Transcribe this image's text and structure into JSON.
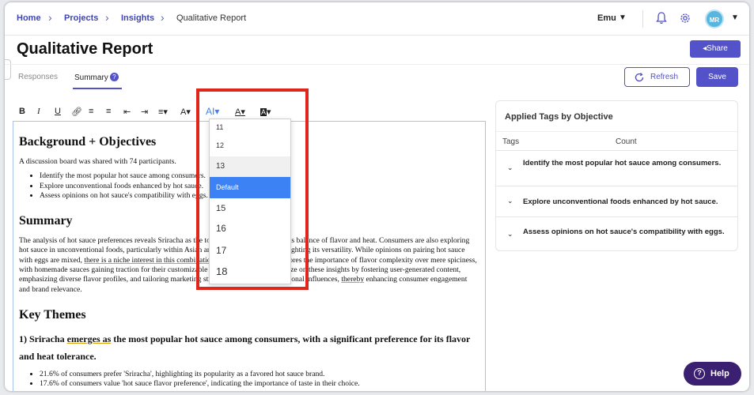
{
  "breadcrumb": [
    {
      "label": "Home"
    },
    {
      "label": "Projects"
    },
    {
      "label": "Insights"
    },
    {
      "label": "Qualitative Report"
    }
  ],
  "user": {
    "name": "Emu",
    "initials": "MR"
  },
  "page": {
    "title": "Qualitative Report",
    "share_label": "Share"
  },
  "tabs": [
    {
      "label": "Responses",
      "active": false
    },
    {
      "label": "Summary",
      "active": true,
      "badge": "?"
    }
  ],
  "actions": {
    "refresh_label": "Refresh",
    "save_label": "Save"
  },
  "toolbar": {
    "bold": "B",
    "italic": "I",
    "underline": "U",
    "font_size_icon": "AI",
    "text_color_icon": "A",
    "highlight_icon": "A"
  },
  "font_size_dropdown": {
    "options": [
      "11",
      "12",
      "13",
      "Default",
      "15",
      "16",
      "17",
      "18"
    ],
    "selected": "Default",
    "hovered": "13"
  },
  "document": {
    "h_background": "Background + Objectives",
    "intro": "A discussion board was shared with 74 participants.",
    "objectives": [
      "Identify the most popular hot sauce among consumers.",
      "Explore unconventional foods enhanced by hot sauce.",
      "Assess opinions on hot sauce's compatibility with eggs."
    ],
    "h_summary": "Summary",
    "summary_p1": "The analysis of hot sauce preferences reveals Sriracha as the top choice, appreciated for its balance of flavor and heat. Consumers are also exploring hot sauce in unconventional foods, particularly within Asian and Mexican cuisines, highlighting its versatility. While opinions on pairing hot sauce with eggs are mixed, ",
    "summary_niche": "there is a niche interest in this combination",
    "summary_p2": ". The discussion underscores the importance of flavor complexity over mere spiciness, with homemade sauces gaining traction for their customizable nature. Brands can capitalize on these insights by fostering user-generated content, emphasizing diverse flavor profiles, and tailoring marketing strategies to cultural and regional influences, ",
    "summary_thereby": "thereby",
    "summary_p3": " enhancing consumer engagement and brand relevance.",
    "h_themes": "Key Themes",
    "theme1_a": "1) Sriracha ",
    "theme1_emerges": "emerges as",
    "theme1_b": " the most popular hot sauce among consumers, with a significant preference for its flavor and heat tolerance.",
    "theme1_points": [
      "21.6% of consumers prefer 'Sriracha', highlighting its popularity as a favored hot sauce brand.",
      "17.6% of consumers value 'hot sauce flavor preference', indicating the importance of taste in their choice."
    ]
  },
  "panel": {
    "title": "Applied Tags by Objective",
    "col_tags": "Tags",
    "col_count": "Count",
    "rows": [
      "Identify the most popular hot sauce among consumers.",
      "Explore unconventional foods enhanced by hot sauce.",
      "Assess opinions on hot sauce's compatibility with eggs."
    ]
  },
  "help_label": "Help",
  "colors": {
    "accent": "#5352c9",
    "highlight_box": "#e0261b",
    "selected_option": "#3d82f4",
    "help_bg": "#3b1f70"
  }
}
